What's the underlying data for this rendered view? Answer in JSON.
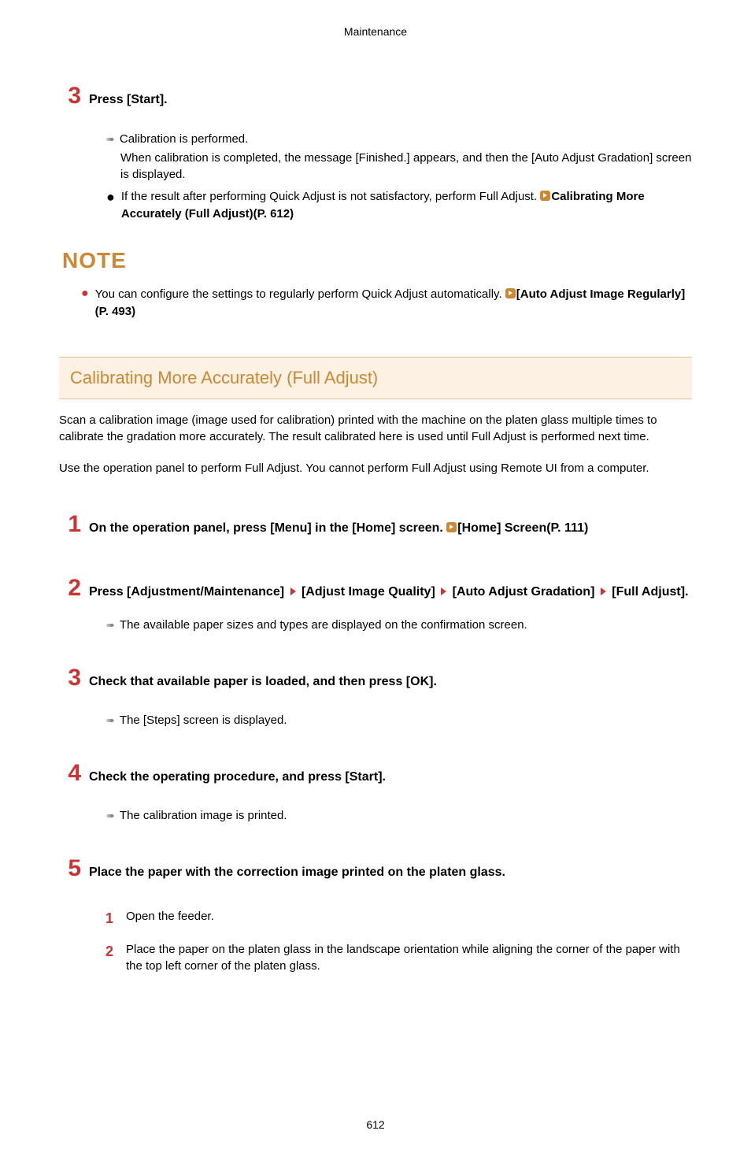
{
  "header": "Maintenance",
  "top_step": {
    "num": "3",
    "title": "Press [Start].",
    "result": "Calibration is performed.",
    "result_line2": "When calibration is completed, the message [Finished.] appears, and then the [Auto Adjust Gradation] screen is displayed.",
    "bullet_text": "If the result after performing Quick Adjust is not satisfactory, perform Full Adjust. ",
    "bullet_link": "Calibrating More Accurately (Full Adjust)(P. 612)"
  },
  "note": {
    "label": "NOTE",
    "text": "You can configure the settings to regularly perform Quick Adjust automatically. ",
    "link": "[Auto Adjust Image Regularly](P. 493)"
  },
  "section": {
    "heading": "Calibrating More Accurately (Full Adjust)",
    "para1": "Scan a calibration image (image used for calibration) printed with the machine on the platen glass multiple times to calibrate the gradation more accurately. The result calibrated here is used until Full Adjust is performed next time.",
    "para2": "Use the operation panel to perform Full Adjust. You cannot perform Full Adjust using Remote UI from a computer."
  },
  "steps": [
    {
      "num": "1",
      "title_prefix": "On the operation panel, press [Menu] in the [Home] screen. ",
      "title_link": "[Home] Screen(P. 111)"
    },
    {
      "num": "2",
      "title_segments": [
        "Press [Adjustment/Maintenance]",
        "[Adjust Image Quality]",
        "[Auto Adjust Gradation]",
        "[Full Adjust]."
      ],
      "result": "The available paper sizes and types are displayed on the confirmation screen."
    },
    {
      "num": "3",
      "title": "Check that available paper is loaded, and then press [OK].",
      "result": "The [Steps] screen is displayed."
    },
    {
      "num": "4",
      "title": "Check the operating procedure, and press [Start].",
      "result": "The calibration image is printed."
    },
    {
      "num": "5",
      "title": "Place the paper with the correction image printed on the platen glass.",
      "substeps": [
        {
          "num": "1",
          "text": "Open the feeder."
        },
        {
          "num": "2",
          "text": "Place the paper on the platen glass in the landscape orientation while aligning the corner of the paper with the top left corner of the platen glass."
        }
      ]
    }
  ],
  "page_number": "612"
}
